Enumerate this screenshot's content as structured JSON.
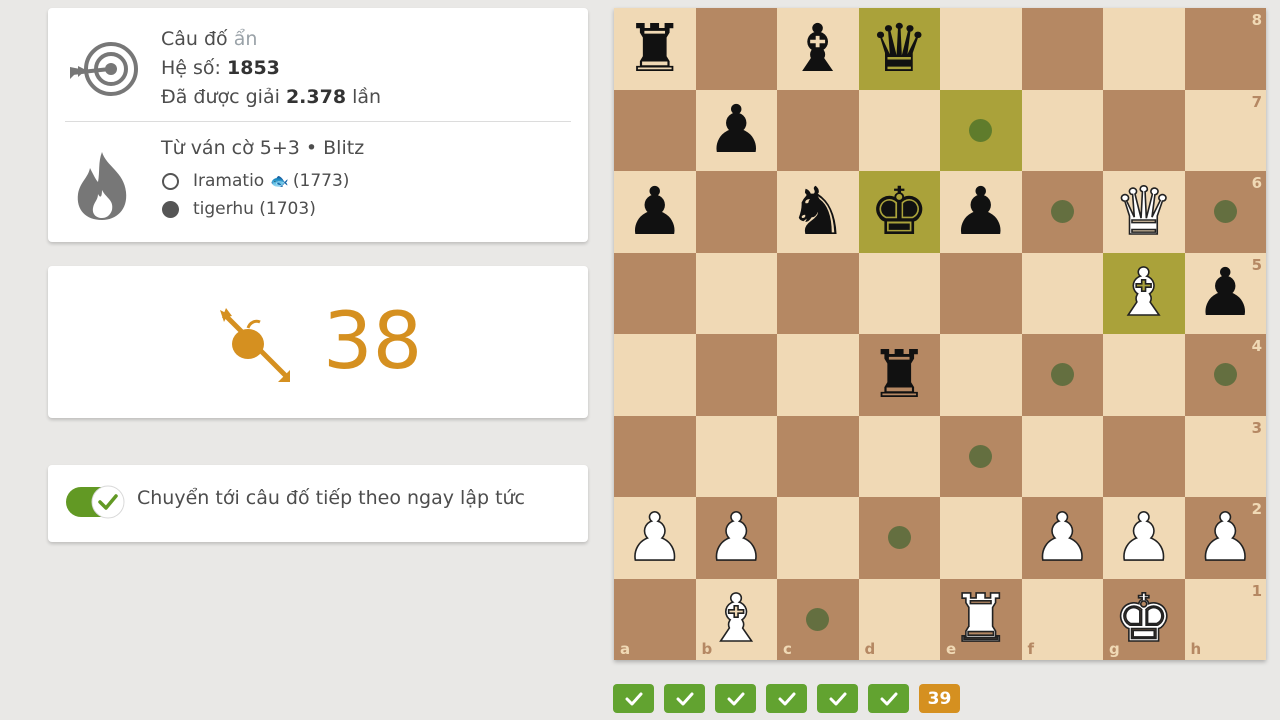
{
  "puzzle_info": {
    "title_prefix": "Câu đố",
    "title_hidden": "ẩn",
    "rating_label": "Hệ số:",
    "rating_value": "1853",
    "solved_prefix": "Đã được giải",
    "solved_count": "2.378",
    "solved_suffix": "lần",
    "icon": "target-arrow-icon"
  },
  "game_info": {
    "source": "Từ ván cờ 5+3 • Blitz",
    "icon": "flame-icon",
    "white_player": "Iramatio",
    "white_rating": "(1773)",
    "white_badge": "fish-icon",
    "black_player": "tigerhu",
    "black_rating": "(1703)"
  },
  "score": {
    "value": "38",
    "icon": "arrow-apple-icon",
    "color": "#d59020"
  },
  "auto_next": {
    "label": "Chuyển tới câu đố tiếp theo ngay lập tức",
    "enabled": true
  },
  "board": {
    "light_color": "#f0d9b5",
    "dark_color": "#b58863",
    "files": [
      "a",
      "b",
      "c",
      "d",
      "e",
      "f",
      "g",
      "h"
    ],
    "ranks": [
      "8",
      "7",
      "6",
      "5",
      "4",
      "3",
      "2",
      "1"
    ],
    "pieces": [
      {
        "sq": "a8",
        "p": "r"
      },
      {
        "sq": "c8",
        "p": "b"
      },
      {
        "sq": "d8",
        "p": "q"
      },
      {
        "sq": "b7",
        "p": "p"
      },
      {
        "sq": "a6",
        "p": "p"
      },
      {
        "sq": "c6",
        "p": "n"
      },
      {
        "sq": "d6",
        "p": "k"
      },
      {
        "sq": "e6",
        "p": "p"
      },
      {
        "sq": "g6",
        "p": "Q"
      },
      {
        "sq": "g5",
        "p": "B"
      },
      {
        "sq": "h5",
        "p": "p"
      },
      {
        "sq": "d4",
        "p": "r"
      },
      {
        "sq": "a2",
        "p": "P"
      },
      {
        "sq": "b2",
        "p": "P"
      },
      {
        "sq": "f2",
        "p": "P"
      },
      {
        "sq": "g2",
        "p": "P"
      },
      {
        "sq": "h2",
        "p": "P"
      },
      {
        "sq": "b1",
        "p": "B"
      },
      {
        "sq": "e1",
        "p": "R"
      },
      {
        "sq": "g1",
        "p": "K"
      }
    ],
    "last_move_squares": [
      "d8",
      "g5"
    ],
    "selected_squares": [
      "e7",
      "d6"
    ],
    "move_dots": [
      "e7",
      "f6",
      "h6",
      "f4",
      "h4",
      "e3",
      "d2",
      "c1"
    ]
  },
  "streak": {
    "solved": 6,
    "current": "39",
    "solved_color": "#62a330"
  }
}
